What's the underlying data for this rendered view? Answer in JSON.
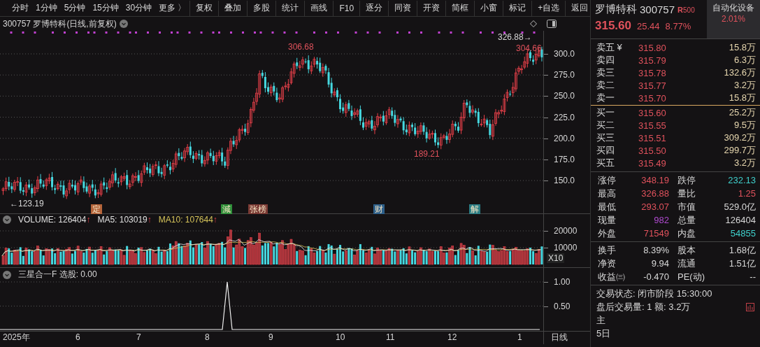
{
  "toolbar": {
    "periods": [
      "分时",
      "1分钟",
      "5分钟",
      "15分钟",
      "30分钟",
      "更多 〉"
    ],
    "actions": [
      "复权",
      "叠加",
      "多股",
      "统计",
      "画线",
      "F10",
      "逐分",
      "同资",
      "开资",
      "简框",
      "小窗",
      "标记",
      "+自选",
      "返回"
    ]
  },
  "chart": {
    "title": "300757 罗博特科(日线,前复权)",
    "price_ticks": [
      "300.0",
      "275.0",
      "250.0",
      "225.0",
      "200.0",
      "175.0",
      "150.0"
    ],
    "price_labels": [
      "306.68",
      "326.88→",
      "304.66",
      "189.21",
      "←123.19"
    ],
    "events": [
      {
        "text": "定",
        "color": "#b5643a"
      },
      {
        "text": "減",
        "color": "#2f8f3a"
      },
      {
        "text": "张榜",
        "color": "#7a3a34"
      },
      {
        "text": "财",
        "color": "#2d5f8a"
      },
      {
        "text": "解",
        "color": "#2a7d85"
      }
    ]
  },
  "volume": {
    "legend": [
      {
        "text": "VOLUME: 126404",
        "color": "#e0e0e0",
        "arrow": "↑"
      },
      {
        "text": "MA5: 103019",
        "color": "#e0e0e0",
        "arrow": "↑"
      },
      {
        "text": "MA10: 107644",
        "color": "#d6c45a",
        "arrow": "↑"
      }
    ],
    "ticks": [
      "20000",
      "10000"
    ],
    "multiplier": "X10"
  },
  "indicator": {
    "legend": "三星合一F  选股: 0.00",
    "ticks": [
      "1.00",
      "0.50"
    ]
  },
  "dates": [
    "2025年",
    "6",
    "7",
    "8",
    "9",
    "10",
    "11",
    "12",
    "1"
  ],
  "period": "日线",
  "quote": {
    "name": "罗博特科",
    "code": "300757",
    "badge_letter": "R",
    "badge_number": "500",
    "price": "315.60",
    "change": "25.44",
    "percent": "8.77%",
    "sector": "自动化设备",
    "sector_percent": "2.01%"
  },
  "asks": [
    {
      "label": "卖五 ¥",
      "price": "315.80",
      "volume": "15.8万"
    },
    {
      "label": "卖四",
      "price": "315.79",
      "volume": "6.3万"
    },
    {
      "label": "卖三",
      "price": "315.78",
      "volume": "132.6万"
    },
    {
      "label": "卖二",
      "price": "315.77",
      "volume": "3.2万"
    },
    {
      "label": "卖一",
      "price": "315.70",
      "volume": "15.8万"
    }
  ],
  "bids": [
    {
      "label": "买一",
      "price": "315.60",
      "volume": "25.2万"
    },
    {
      "label": "买二",
      "price": "315.55",
      "volume": "9.5万"
    },
    {
      "label": "买三",
      "price": "315.51",
      "volume": "309.2万"
    },
    {
      "label": "买四",
      "price": "315.50",
      "volume": "299.7万"
    },
    {
      "label": "买五",
      "price": "315.49",
      "volume": "3.2万"
    }
  ],
  "stats": [
    [
      {
        "label": "涨停",
        "value": "348.19",
        "color": "#e0525c"
      },
      {
        "label": "跌停",
        "value": "232.13",
        "color": "#3fd0cc"
      }
    ],
    [
      {
        "label": "最高",
        "value": "326.88",
        "color": "#e0525c"
      },
      {
        "label": "量比",
        "value": "1.25",
        "color": "#e0525c"
      }
    ],
    [
      {
        "label": "最低",
        "value": "293.07",
        "color": "#e0525c"
      },
      {
        "label": "市值",
        "value": "529.0亿",
        "color": "#d8d8d8"
      }
    ],
    [
      {
        "label": "现量",
        "value": "982",
        "color": "#b04ad0"
      },
      {
        "label": "总量",
        "value": "126404",
        "color": "#d8d8d8"
      }
    ],
    [
      {
        "label": "外盘",
        "value": "71549",
        "color": "#e0525c"
      },
      {
        "label": "内盘",
        "value": "54855",
        "color": "#3fd0cc"
      }
    ]
  ],
  "finance": [
    [
      {
        "label": "换手",
        "value": "8.39%"
      },
      {
        "label": "股本",
        "value": "1.68亿"
      }
    ],
    [
      {
        "label": "净资",
        "value": "9.94"
      },
      {
        "label": "流通",
        "value": "1.51亿"
      }
    ],
    [
      {
        "label": "收益㈢",
        "value": "-0.470"
      },
      {
        "label": "PE(动)",
        "value": "--"
      }
    ]
  ],
  "status_lines": [
    "交易状态: 闭市阶段 15:30:00",
    "盘后交易量: 1  额: 3.2万",
    "主",
    "5日"
  ]
}
